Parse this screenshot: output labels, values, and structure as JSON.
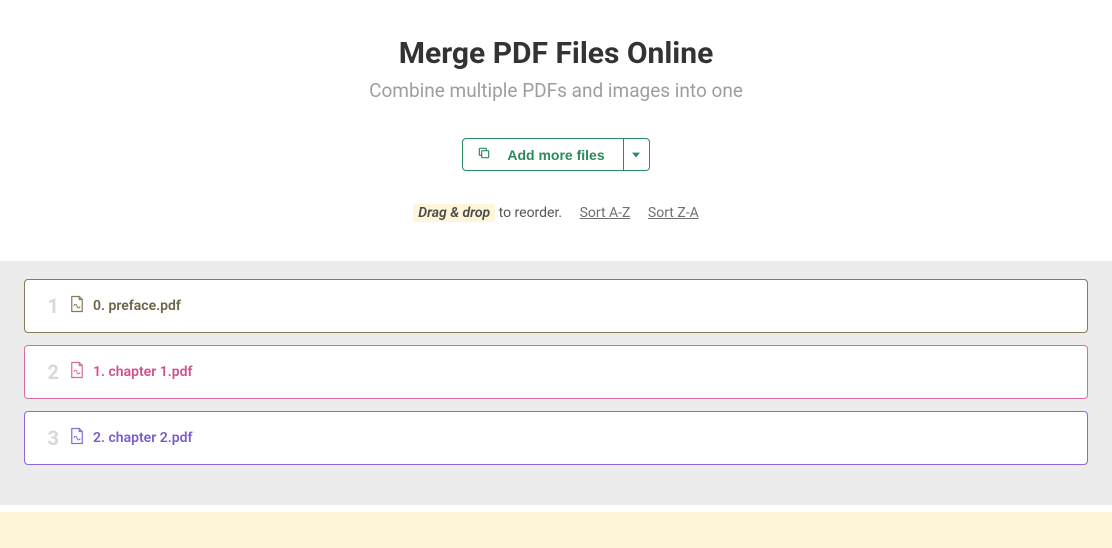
{
  "header": {
    "title": "Merge PDF Files Online",
    "subtitle": "Combine multiple PDFs and images into one"
  },
  "toolbar": {
    "add_more_label": "Add more files"
  },
  "hint": {
    "highlight": "Drag & drop",
    "rest": " to reorder.",
    "sort_az": "Sort A-Z",
    "sort_za": "Sort Z-A"
  },
  "files": [
    {
      "index": "1",
      "name": "0. preface.pdf",
      "color": "#8a7a5c"
    },
    {
      "index": "2",
      "name": "1. chapter 1.pdf",
      "color": "#d96aa0"
    },
    {
      "index": "3",
      "name": "2. chapter 2.pdf",
      "color": "#8a6ad9"
    }
  ]
}
